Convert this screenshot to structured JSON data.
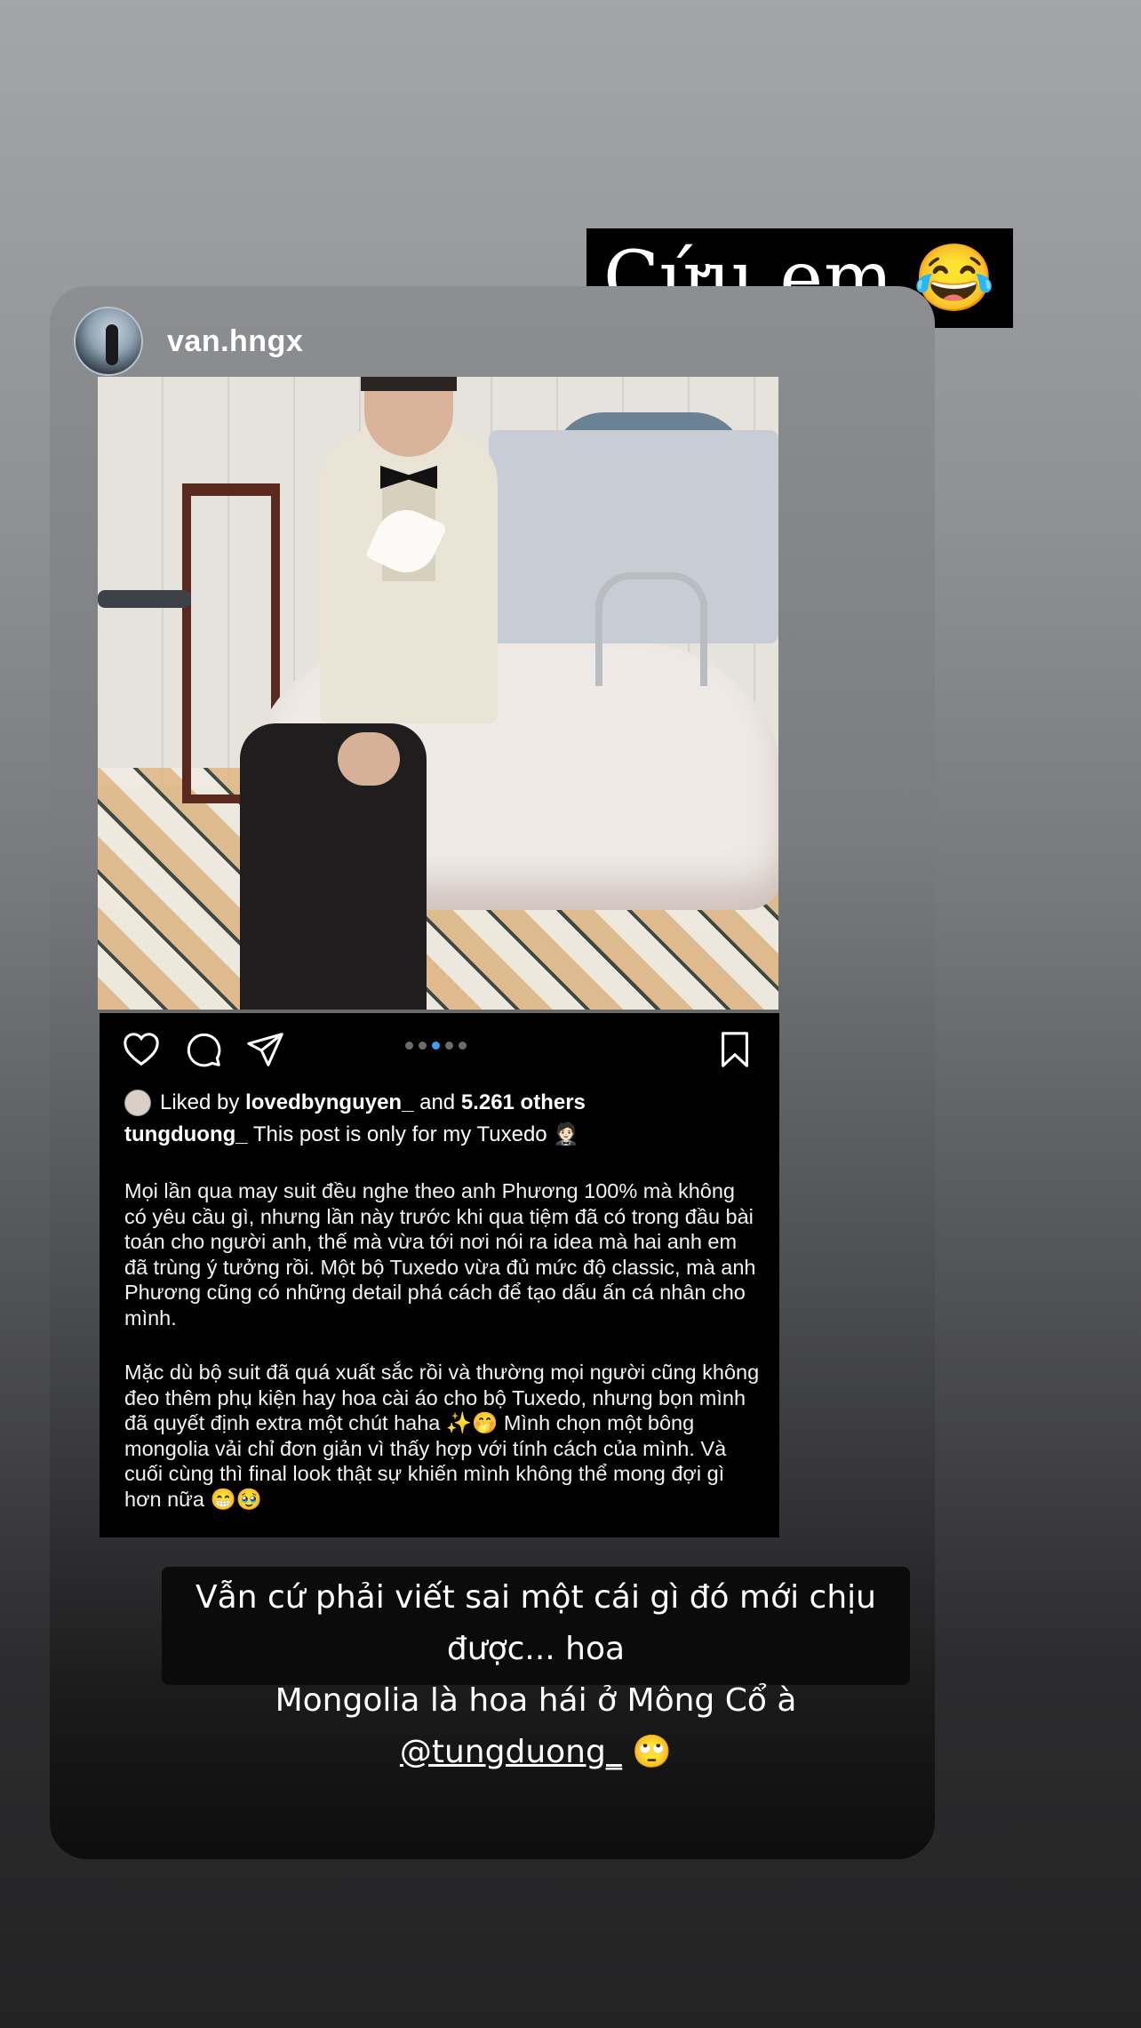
{
  "top_sticker": {
    "text": "Cứu em",
    "emoji": "😂"
  },
  "post": {
    "username": "van.hngx",
    "likes": {
      "prefix": "Liked by",
      "user": "lovedbynguyen_",
      "and": "and",
      "others": "5.261 others"
    },
    "author": "tungduong_",
    "caption_title": "This post is only for my Tuxedo 🤵🏻",
    "paragraph1": "Mọi lần qua may suit đều nghe theo anh Phương 100% mà không có yêu cầu gì, nhưng lần này trước khi qua tiệm đã có trong đầu bài toán cho người anh, thế mà vừa tới nơi nói ra idea mà hai anh em đã trùng ý tưởng rồi. Một bộ Tuxedo vừa đủ mức độ classic, mà anh Phương cũng có những detail phá cách để tạo dấu ấn cá nhân cho mình.",
    "paragraph2": "Mặc dù bộ suit đã quá xuất sắc rồi và thường mọi người cũng không đeo thêm phụ kiện hay hoa cài áo cho bộ Tuxedo, nhưng bọn mình đã quyết định extra một chút haha ✨🤭 Mình chọn một bông mongolia vải chỉ đơn giản vì thấy hợp với tính cách của mình. Và cuối cùng thì final look thật sự khiến mình không thể mong đợi gì hơn nữa 😁🥹",
    "carousel": {
      "count": 5,
      "active_index": 2
    }
  },
  "bottom_sticker": {
    "line1": "Vẫn cứ phải viết sai một cái gì đó mới chịu được... hoa",
    "line2": "Mongolia là hoa hái ở Mông Cổ à",
    "mention": "@tungduong_",
    "emoji": "🙄"
  },
  "icons": [
    "heart-icon",
    "comment-icon",
    "share-icon",
    "bookmark-icon",
    "mute-icon"
  ]
}
